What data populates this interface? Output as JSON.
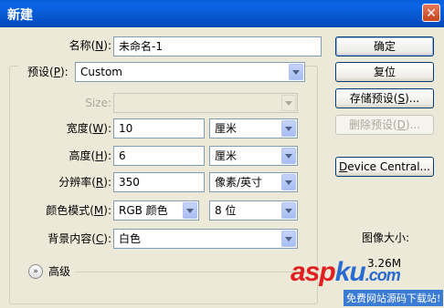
{
  "window": {
    "title": "新建",
    "close_glyph": "✕"
  },
  "form": {
    "name": {
      "label": "名称(",
      "key": "N",
      "suffix": "):",
      "value": "未命名-1"
    },
    "preset": {
      "label": "预设(",
      "key": "P",
      "suffix": "):",
      "value": "Custom"
    },
    "size": {
      "label": "Size:",
      "value": ""
    },
    "width": {
      "label": "宽度(",
      "key": "W",
      "suffix": "):",
      "value": "10",
      "unit": "厘米"
    },
    "height": {
      "label": "高度(",
      "key": "H",
      "suffix": "):",
      "value": "6",
      "unit": "厘米"
    },
    "resolution": {
      "label": "分辨率(",
      "key": "R",
      "suffix": "):",
      "value": "350",
      "unit": "像素/英寸"
    },
    "color_mode": {
      "label": "颜色模式(",
      "key": "M",
      "suffix": "):",
      "value": "RGB 颜色",
      "depth": "8 位"
    },
    "background": {
      "label": "背景内容(",
      "key": "C",
      "suffix": "):",
      "value": "白色"
    },
    "advanced": {
      "label": "高级",
      "icon_glyph": "»"
    }
  },
  "buttons": {
    "ok": "确定",
    "reset": {
      "label": "复位"
    },
    "save_preset": {
      "pre": "存储预设(",
      "key": "S",
      "post": ")..."
    },
    "delete_preset": {
      "pre": "删除预设(",
      "key": "D",
      "post": ")..."
    },
    "device_central": {
      "pre": "",
      "key": "D",
      "post": "evice Central..."
    }
  },
  "image_size": {
    "title": "图像大小:",
    "value": "3.26M"
  },
  "watermark": {
    "main_a": "asp",
    "main_b": "ku",
    "main_c": ".com",
    "sub": "免费网站源码下载站!"
  },
  "colors": {
    "titlebar": "#0a5fd8",
    "dialog_bg": "#ece9d8",
    "field_border": "#7f9db9"
  }
}
